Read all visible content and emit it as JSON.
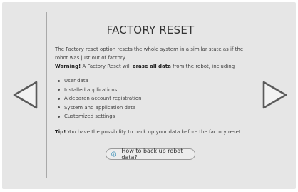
{
  "page": {
    "title": "FACTORY RESET",
    "intro": "The Factory reset option resets the whole system in a similar state as if the robot was just out of factory.",
    "warning_label": "Warning!",
    "warning_pre": " A Factory Reset will ",
    "warning_bold": "erase all data",
    "warning_post": " from the robot, including :",
    "items": [
      "User data",
      "Installed applications",
      "Aldebaran account registration",
      "System and application data",
      "Customized settings"
    ],
    "tip_label": "Tip!",
    "tip_text": " You have the possibility to back up your data before the factory reset.",
    "help_button_label": "How to back up robot data?"
  },
  "nav": {
    "prev_icon": "chevron-left-icon",
    "next_icon": "chevron-right-icon"
  },
  "colors": {
    "background": "#e6e6e6",
    "arrow_stroke": "#5a5a5a",
    "info_icon": "#3a8fb7"
  }
}
